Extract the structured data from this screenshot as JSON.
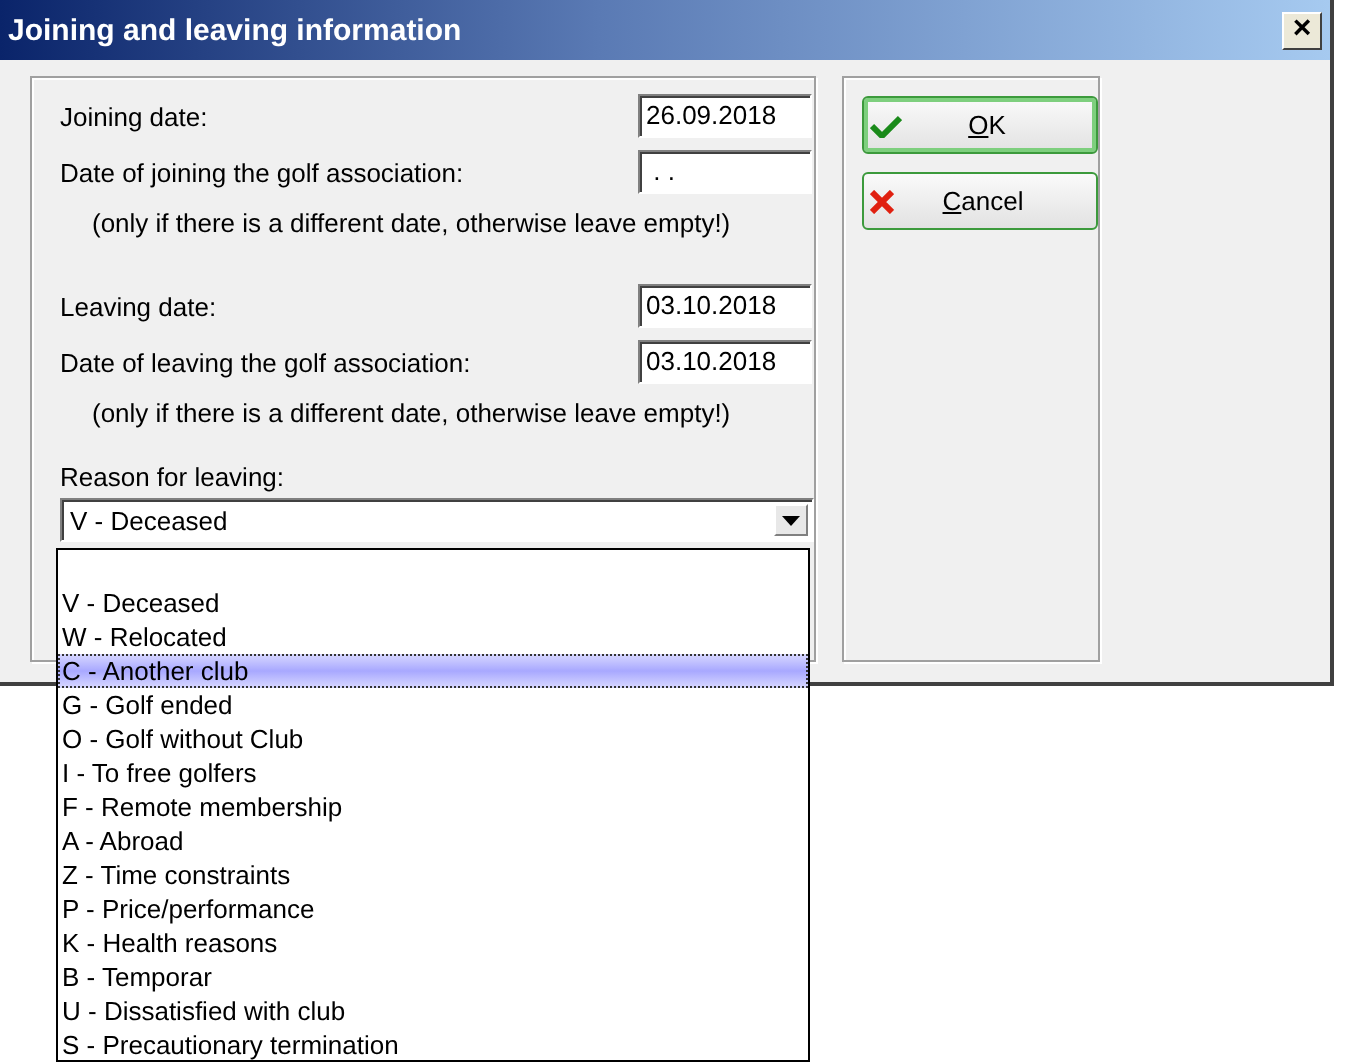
{
  "window": {
    "title": "Joining and leaving information",
    "close": "×"
  },
  "joining": [
    {
      "label": "Joining date:",
      "value": "26.09.2018"
    },
    {
      "label": "Date of joining the golf association:",
      "value": " . ."
    }
  ],
  "joining_hint": "(only if there is a different date, otherwise leave empty!)",
  "leaving": [
    {
      "label": "Leaving date:",
      "value": "03.10.2018"
    },
    {
      "label": "Date of leaving the golf association:",
      "value": "03.10.2018"
    }
  ],
  "leaving_hint": "(only if there is a different date, otherwise leave empty!)",
  "reason": {
    "label": "Reason for leaving:",
    "value": "V - Deceased",
    "expanded": true,
    "options": [
      {
        "label": "V - Deceased",
        "highlighted": false
      },
      {
        "label": "W - Relocated",
        "highlighted": false
      },
      {
        "label": "C - Another club",
        "highlighted": true
      },
      {
        "label": "G - Golf ended",
        "highlighted": false
      },
      {
        "label": "O - Golf without Club",
        "highlighted": false
      },
      {
        "label": "I - To free golfers",
        "highlighted": false
      },
      {
        "label": "F - Remote membership",
        "highlighted": false
      },
      {
        "label": "A - Abroad",
        "highlighted": false
      },
      {
        "label": "Z - Time constraints",
        "highlighted": false
      },
      {
        "label": "P - Price/performance",
        "highlighted": false
      },
      {
        "label": "K - Health reasons",
        "highlighted": false
      },
      {
        "label": "B - Temporar",
        "highlighted": false
      },
      {
        "label": "U - Dissatisfied with club",
        "highlighted": false
      },
      {
        "label": "S - Precautionary termination",
        "highlighted": false
      }
    ]
  },
  "buttons": [
    {
      "kind": "ok",
      "label": "OK"
    },
    {
      "kind": "cancel",
      "label": "Cancel"
    }
  ]
}
